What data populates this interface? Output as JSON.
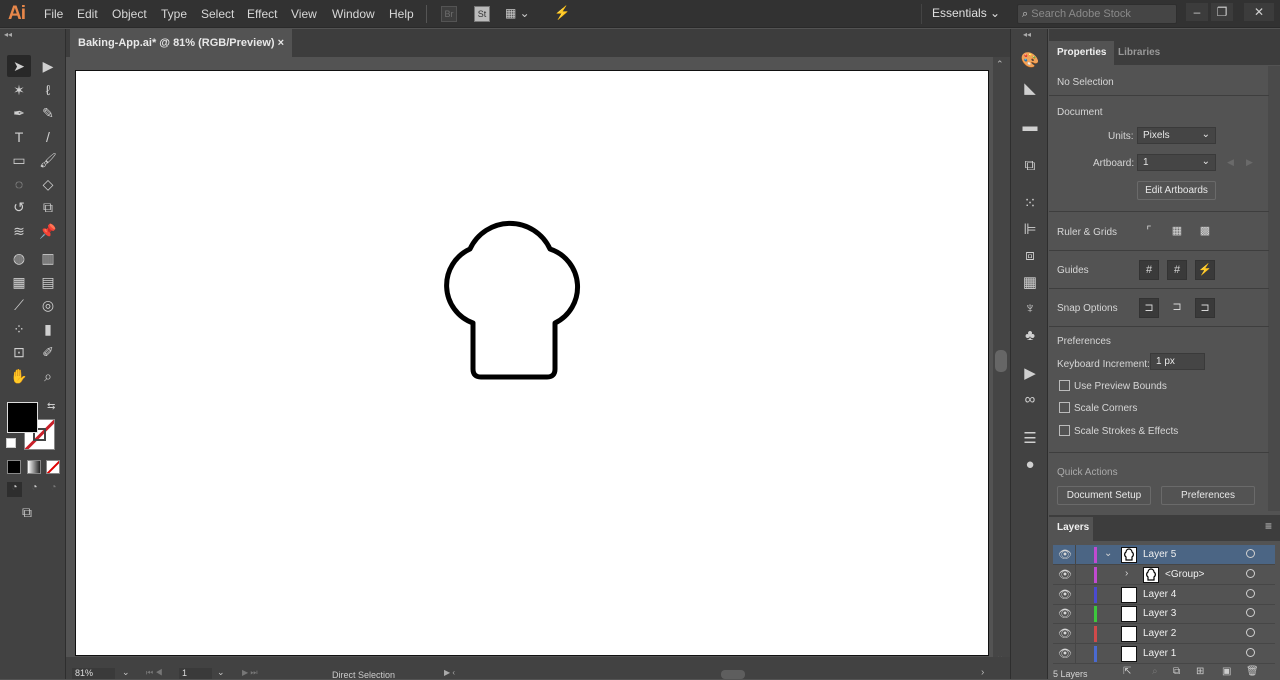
{
  "app": {
    "logo": "Ai"
  },
  "menu": [
    "File",
    "Edit",
    "Object",
    "Type",
    "Select",
    "Effect",
    "View",
    "Window",
    "Help"
  ],
  "toolbar_icons": {
    "bridge": "Br",
    "stock": "St",
    "arrange": "▦ ⌄",
    "gpu": "⚡"
  },
  "workspace": {
    "label": "Essentials ⌄"
  },
  "search": {
    "placeholder": "Search Adobe Stock",
    "icon": "⌕"
  },
  "window_controls": {
    "minimize": "‒",
    "restore": "❐",
    "close": "✕"
  },
  "document_tab": {
    "title": "Baking-App.ai* @ 81% (RGB/Preview)",
    "close": "×"
  },
  "tools": [
    [
      "selection-tool",
      "➤"
    ],
    [
      "direct-selection-tool",
      "▶"
    ],
    [
      "magic-wand-tool",
      "✶"
    ],
    [
      "lasso-tool",
      "ℓ"
    ],
    [
      "pen-tool",
      "✒"
    ],
    [
      "curvature-tool",
      "✎"
    ],
    [
      "type-tool",
      "T"
    ],
    [
      "line-tool",
      "/"
    ],
    [
      "rectangle-tool",
      "▭"
    ],
    [
      "paintbrush-tool",
      "🖌"
    ],
    [
      "shaper-tool",
      "◌"
    ],
    [
      "eraser-tool",
      "◇"
    ],
    [
      "rotate-tool",
      "↺"
    ],
    [
      "scale-tool",
      "⧉"
    ],
    [
      "warp-tool",
      "≋"
    ],
    [
      "puppet-warp-tool",
      "📌"
    ],
    [
      "shape-builder-tool",
      "◍"
    ],
    [
      "perspective-grid-tool",
      "▥"
    ],
    [
      "mesh-tool",
      "▦"
    ],
    [
      "gradient-tool",
      "▤"
    ],
    [
      "eyedropper-tool",
      "⟋"
    ],
    [
      "blend-tool",
      "◎"
    ],
    [
      "symbol-sprayer-tool",
      "⁘"
    ],
    [
      "column-graph-tool",
      "▮"
    ],
    [
      "artboard-tool",
      "⊡"
    ],
    [
      "slice-tool",
      "✐"
    ],
    [
      "hand-tool",
      "✋"
    ],
    [
      "zoom-tool",
      "⌕"
    ]
  ],
  "properties": {
    "tabs": [
      "Properties",
      "Libraries"
    ],
    "selection": "No Selection",
    "document_heading": "Document",
    "units_label": "Units:",
    "units_value": "Pixels",
    "artboard_label": "Artboard:",
    "artboard_value": "1",
    "edit_artboards": "Edit Artboards",
    "ruler_grids": "Ruler & Grids",
    "guides": "Guides",
    "snap_options": "Snap Options",
    "preferences_heading": "Preferences",
    "keyboard_increment_label": "Keyboard Increment:",
    "keyboard_increment_value": "1 px",
    "checkboxes": [
      {
        "label": "Use Preview Bounds",
        "checked": false
      },
      {
        "label": "Scale Corners",
        "checked": false
      },
      {
        "label": "Scale Strokes & Effects",
        "checked": false
      }
    ],
    "quick_actions": "Quick Actions",
    "document_setup": "Document Setup",
    "preferences_button": "Preferences"
  },
  "layers": {
    "title": "Layers",
    "count": "5 Layers",
    "rows": [
      {
        "name": "Layer 5",
        "color": "#c04ad0",
        "expanded": true,
        "selected": true,
        "indent": 0,
        "thumb": "hat"
      },
      {
        "name": "<Group>",
        "color": "#c04ad0",
        "expanded": false,
        "selected": false,
        "indent": 1,
        "thumb": "hat"
      },
      {
        "name": "Layer 4",
        "color": "#4a4ad0",
        "selected": false,
        "indent": 0,
        "thumb": "blank"
      },
      {
        "name": "Layer 3",
        "color": "#3cc83c",
        "selected": false,
        "indent": 0,
        "thumb": "blank"
      },
      {
        "name": "Layer 2",
        "color": "#d04a4a",
        "selected": false,
        "indent": 0,
        "thumb": "blank"
      },
      {
        "name": "Layer 1",
        "color": "#4a6ad0",
        "selected": false,
        "indent": 0,
        "thumb": "blank"
      }
    ]
  },
  "status": {
    "zoom": "81%",
    "artboard_nav": "1",
    "current_tool": "Direct Selection"
  }
}
